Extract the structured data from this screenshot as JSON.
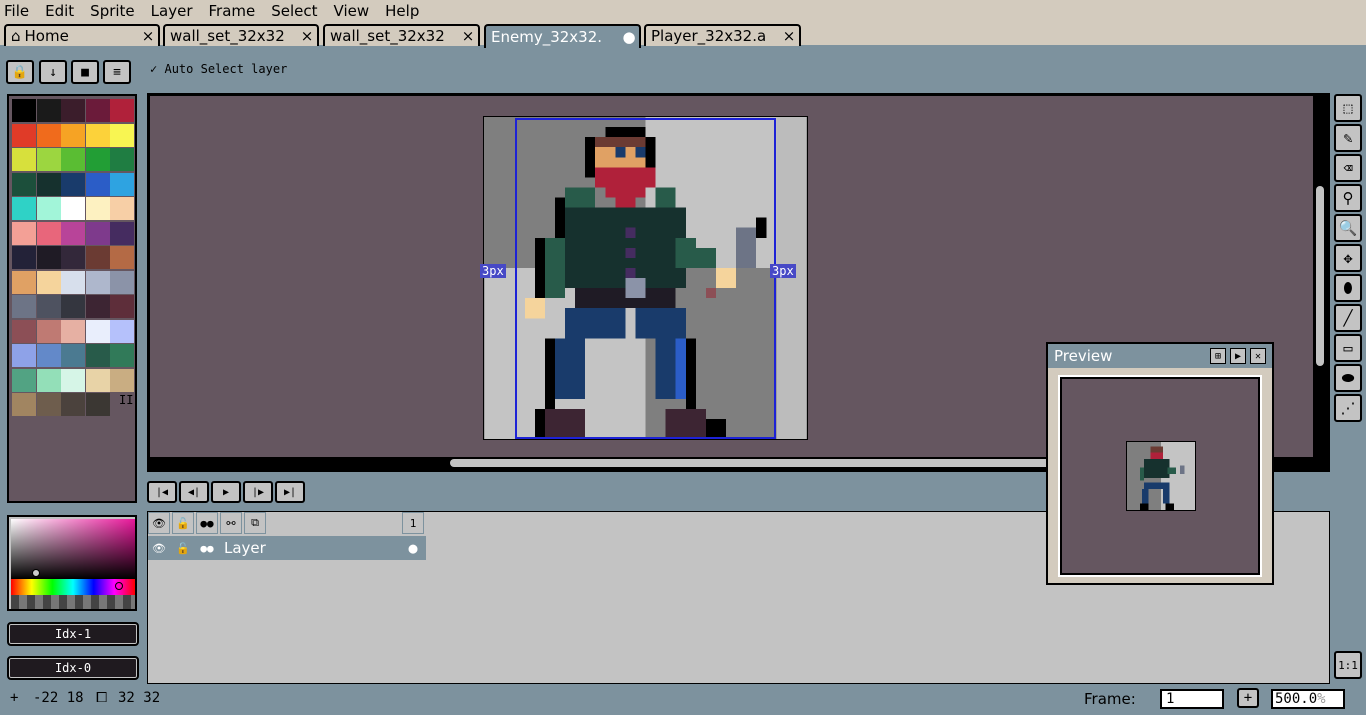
{
  "menu": [
    "File",
    "Edit",
    "Sprite",
    "Layer",
    "Frame",
    "Select",
    "View",
    "Help"
  ],
  "tabs": [
    {
      "label": "Home",
      "close": "×",
      "icon": "home-icon"
    },
    {
      "label": "wall_set_32x32",
      "close": "×"
    },
    {
      "label": "wall_set_32x32",
      "close": "×"
    },
    {
      "label": "Enemy_32x32.",
      "close": "●",
      "active": true
    },
    {
      "label": "Player_32x32.a",
      "close": "×"
    }
  ],
  "toolbar": {
    "auto_select_check": "✓",
    "auto_select_label": "Auto Select layer",
    "buttons": [
      {
        "icon": "lock-icon",
        "glyph": "🔒"
      },
      {
        "icon": "arrow-down-icon",
        "glyph": "↓"
      },
      {
        "icon": "square-icon",
        "glyph": "■"
      },
      {
        "icon": "menu-icon",
        "glyph": "≡"
      }
    ]
  },
  "palette": {
    "colors": [
      "#000000",
      "#1a1a1a",
      "#3b1d2b",
      "#6b1b3a",
      "#b0213a",
      "#e03b28",
      "#f06b1c",
      "#f6a324",
      "#fcd23a",
      "#f8f552",
      "#d7e03c",
      "#9cd640",
      "#5abd33",
      "#229e35",
      "#1f7d42",
      "#1c4f3b",
      "#16312e",
      "#193b6b",
      "#2b5dc7",
      "#2ea3e1",
      "#2fd2c6",
      "#a2f5d9",
      "#ffffff",
      "#fdf1c1",
      "#f7cfa6",
      "#f3a096",
      "#e8667b",
      "#b84499",
      "#7e3a8c",
      "#452c60",
      "#232238",
      "#1f1b25",
      "#33283a",
      "#6b3b33",
      "#b46a45",
      "#e0a164",
      "#f5d49c",
      "#d7dfec",
      "#aeb7cc",
      "#8b93a8",
      "#6d7486",
      "#4e5260",
      "#34363f",
      "#3d2533",
      "#5e2e3a",
      "#8c4f56",
      "#bf7a73",
      "#e6b0a3",
      "#e9eefc",
      "#b5c1fb",
      "#8ea2e8",
      "#6389c9",
      "#4b7a91",
      "#285b4a",
      "#317a59",
      "#52a383",
      "#93dfb8",
      "#d6f5e7",
      "#e8d3a7",
      "#c9ad82",
      "#a18561",
      "#6e5d4d",
      "#4b423d",
      "#3b3733"
    ],
    "more_glyph": "II"
  },
  "color_idx": {
    "fg": "Idx-1",
    "bg": "Idx-0"
  },
  "editor": {
    "left_px_label": "3px",
    "right_px_label": "3px"
  },
  "tools": [
    {
      "icon": "marquee-icon",
      "glyph": "⬚"
    },
    {
      "icon": "pencil-icon",
      "glyph": "✎"
    },
    {
      "icon": "eraser-icon",
      "glyph": "⌫"
    },
    {
      "icon": "eyedropper-icon",
      "glyph": "⚲"
    },
    {
      "icon": "zoom-icon",
      "glyph": "🔍"
    },
    {
      "icon": "move-icon",
      "glyph": "✥"
    },
    {
      "icon": "fill-icon",
      "glyph": "⬮"
    },
    {
      "icon": "line-icon",
      "glyph": "╱"
    },
    {
      "icon": "rectangle-icon",
      "glyph": "▭"
    },
    {
      "icon": "blob-icon",
      "glyph": "⬬"
    },
    {
      "icon": "spray-icon",
      "glyph": "⋰"
    }
  ],
  "animation": [
    {
      "icon": "first-frame-icon",
      "glyph": "|◀"
    },
    {
      "icon": "prev-frame-icon",
      "glyph": "◀|"
    },
    {
      "icon": "play-icon",
      "glyph": "▶"
    },
    {
      "icon": "next-frame-icon",
      "glyph": "|▶"
    },
    {
      "icon": "last-frame-icon",
      "glyph": "▶|"
    }
  ],
  "timeline": {
    "header_icons": [
      {
        "icon": "eye-icon",
        "glyph": "👁"
      },
      {
        "icon": "padlock-icon",
        "glyph": "🔓"
      },
      {
        "icon": "continuous-icon",
        "glyph": "●●"
      },
      {
        "icon": "link-icon",
        "glyph": "⚯"
      },
      {
        "icon": "onion-icon",
        "glyph": "⧉"
      }
    ],
    "frame_number": "1",
    "layer": {
      "name": "Layer",
      "cel": "●"
    }
  },
  "preview": {
    "title": "Preview",
    "btn_fit": "⊞",
    "btn_play": "▶",
    "btn_close": "✕"
  },
  "status": {
    "cursor_pos": "-22 18",
    "sprite_size": "32 32",
    "frame_label": "Frame:",
    "frame_value": "1",
    "frame_plus": "+",
    "zoom_value": "500.0",
    "zoom_unit": "%",
    "ratio": "1:1"
  }
}
